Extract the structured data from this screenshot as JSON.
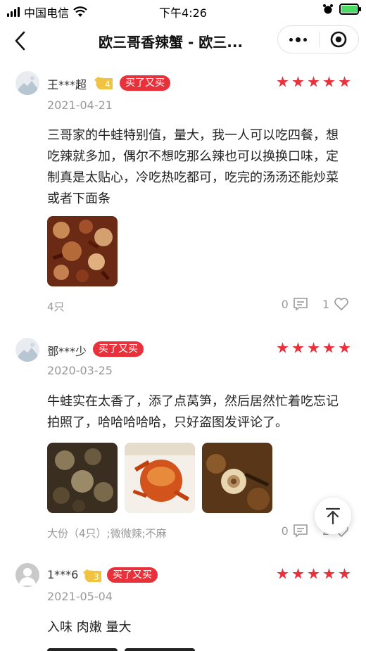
{
  "status_bar": {
    "carrier": "中国电信",
    "time": "下午4:26"
  },
  "nav": {
    "title": "欧三哥香辣蟹 - 欧三..."
  },
  "colors": {
    "accent": "#e8313a",
    "gold": "#f0c341"
  },
  "reviews": [
    {
      "user": "王***超",
      "vip_level": "4",
      "tag": "买了又买",
      "stars": 5,
      "date": "2021-04-21",
      "content": "三哥家的牛蛙特别值，量大，我一人可以吃四餐，想吃辣就多加，偶尔不想吃那么辣也可以换换口味，定制真是太贴心，冷吃热吃都可，吃完的汤汤还能炒菜或者下面条",
      "meta": "4只",
      "comments": "0",
      "likes": "1"
    },
    {
      "user": "鄧***少",
      "tag": "买了又买",
      "stars": 5,
      "date": "2020-03-25",
      "content": "牛蛙实在太香了，添了点莴笋，然后居然忙着吃忘记拍照了，哈哈哈哈哈，只好盗图发评论了。",
      "meta": "大份（4只）;微微辣;不麻",
      "comments": "0",
      "likes": "2"
    },
    {
      "user": "1***6",
      "vip_level": "3",
      "tag": "买了又买",
      "stars": 5,
      "date": "2021-05-04",
      "content": "入味 肉嫩 量大"
    }
  ]
}
